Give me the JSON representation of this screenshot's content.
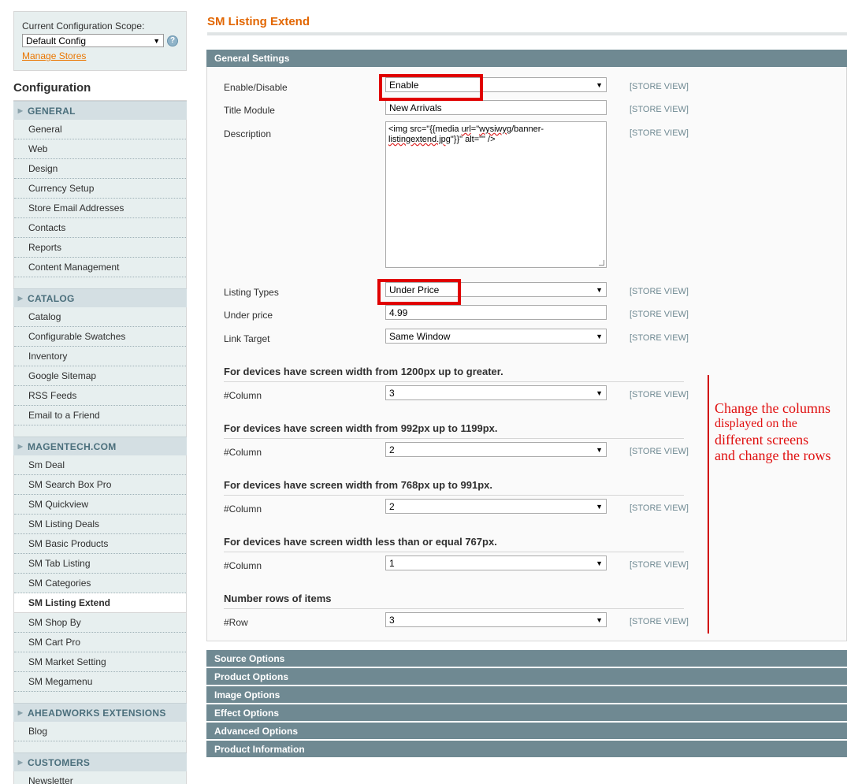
{
  "scope": {
    "label": "Current Configuration Scope:",
    "selected": "Default Config",
    "help_icon": "help-icon",
    "manage_link": "Manage Stores"
  },
  "sidebar": {
    "title": "Configuration",
    "sections": [
      {
        "heading": "GENERAL",
        "items": [
          "General",
          "Web",
          "Design",
          "Currency Setup",
          "Store Email Addresses",
          "Contacts",
          "Reports",
          "Content Management"
        ]
      },
      {
        "heading": "CATALOG",
        "items": [
          "Catalog",
          "Configurable Swatches",
          "Inventory",
          "Google Sitemap",
          "RSS Feeds",
          "Email to a Friend"
        ]
      },
      {
        "heading": "MAGENTECH.COM",
        "items": [
          "Sm Deal",
          "SM Search Box Pro",
          "SM Quickview",
          "SM Listing Deals",
          "SM Basic Products",
          "SM Tab Listing",
          "SM Categories",
          "SM Listing Extend",
          "SM Shop By",
          "SM Cart Pro",
          "SM Market Setting",
          "SM Megamenu"
        ],
        "active": "SM Listing Extend"
      },
      {
        "heading": "AHEADWORKS EXTENSIONS",
        "items": [
          "Blog"
        ]
      },
      {
        "heading": "CUSTOMERS",
        "items": [
          "Newsletter"
        ]
      }
    ]
  },
  "main": {
    "page_title": "SM Listing Extend",
    "general_settings": {
      "heading": "General Settings",
      "scope_tag": "[STORE VIEW]",
      "fields": {
        "enable": {
          "label": "Enable/Disable",
          "value": "Enable"
        },
        "title": {
          "label": "Title Module",
          "value": "New Arrivals"
        },
        "description": {
          "label": "Description",
          "value_pre": "<img src=\"{{media ",
          "value_err1": "url",
          "value_mid": "=\"",
          "value_err2": "wysiwyg",
          "value_post": "/banner-",
          "value_line2_err": "listingextend.jpg",
          "value_line2": "\"}}\" alt=\"\" />"
        },
        "listing_types": {
          "label": "Listing Types",
          "value": "Under Price"
        },
        "under_price": {
          "label": "Under price",
          "value": "4.99"
        },
        "link_target": {
          "label": "Link Target",
          "value": "Same Window"
        }
      },
      "devices": [
        {
          "heading": "For devices have screen width from 1200px up to greater.",
          "label": "#Column",
          "value": "3"
        },
        {
          "heading": "For devices have screen width from 992px up to 1199px.",
          "label": "#Column",
          "value": "2"
        },
        {
          "heading": "For devices have screen width from 768px up to 991px.",
          "label": "#Column",
          "value": "2"
        },
        {
          "heading": "For devices have screen width less than or equal 767px.",
          "label": "#Column",
          "value": "1"
        }
      ],
      "rows": {
        "heading": "Number rows of items",
        "label": "#Row",
        "value": "3"
      }
    },
    "collapsed_sections": [
      "Source Options",
      "Product Options",
      "Image Options",
      "Effect Options",
      "Advanced Options",
      "Product Information"
    ]
  },
  "annotation": {
    "lines": [
      "Change the columns",
      "displayed on the",
      "different screens",
      "and change the rows"
    ],
    "color": "#e01010"
  },
  "colors": {
    "accent_orange": "#e26703",
    "section_bar": "#6f8992",
    "highlight_red": "#e00000"
  }
}
